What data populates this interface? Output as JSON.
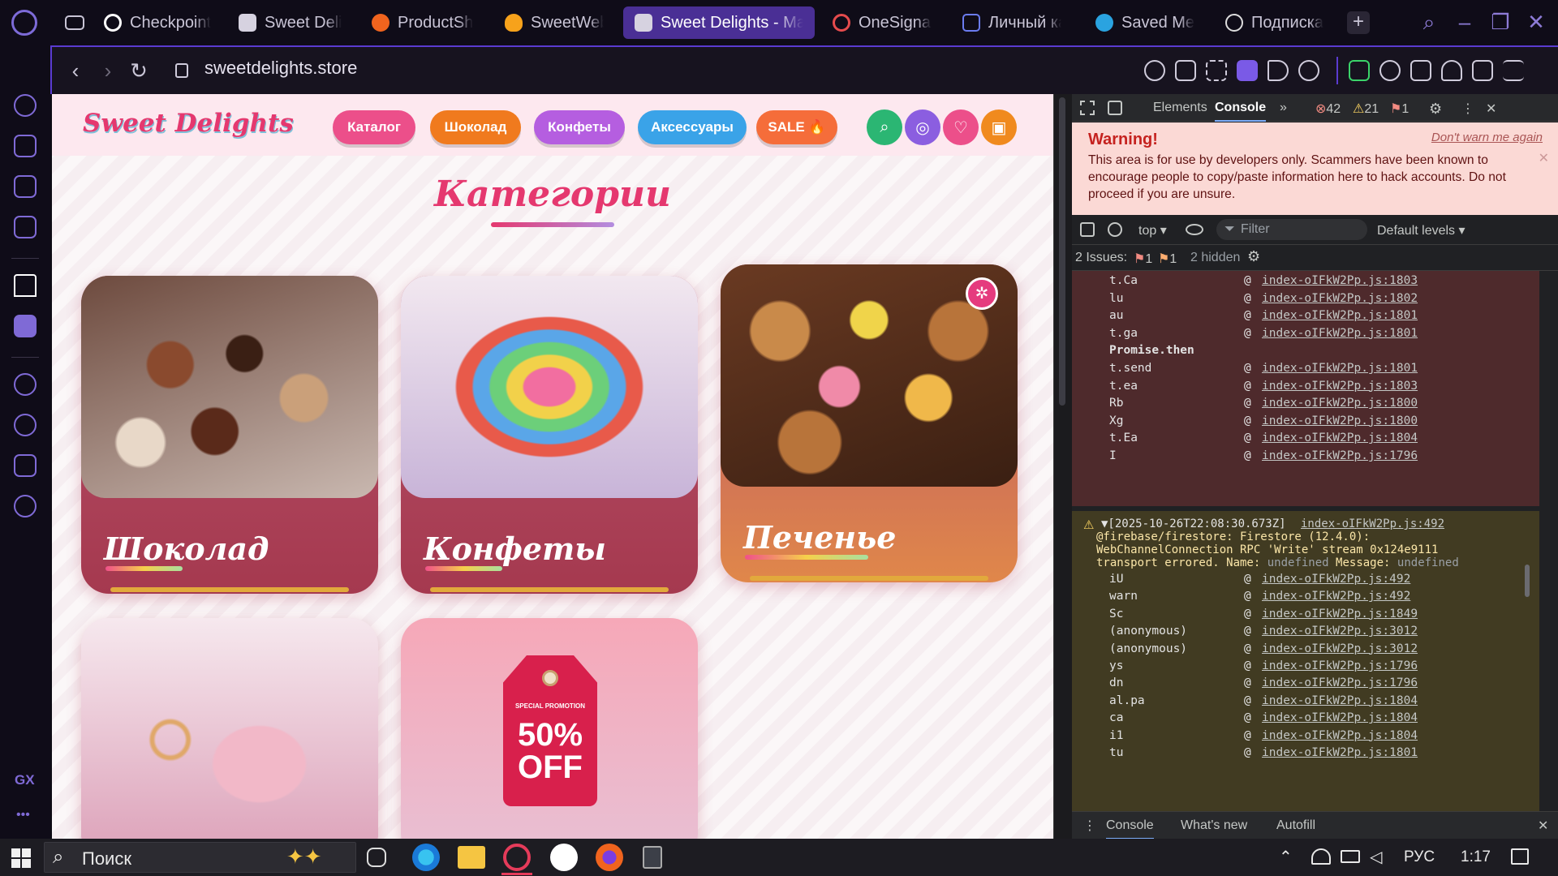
{
  "tabs": [
    {
      "label": "Checkpoint"
    },
    {
      "label": "Sweet Deli"
    },
    {
      "label": "ProductSh"
    },
    {
      "label": "SweetWeb"
    },
    {
      "label": "Sweet Delights - Ma",
      "active": true
    },
    {
      "label": "OneSignal"
    },
    {
      "label": "Личный ка"
    },
    {
      "label": "Saved Mes"
    },
    {
      "label": "Подписка"
    }
  ],
  "address": {
    "url": "sweetdelights.store"
  },
  "sidebar": {
    "bottom_label": "GX",
    "more": "•••"
  },
  "site": {
    "logo": "Sweet Delights",
    "nav": [
      {
        "label": "Каталог",
        "color": "#ec4f8a"
      },
      {
        "label": "Шоколад",
        "color": "#f07a1e"
      },
      {
        "label": "Конфеты",
        "color": "#b55ee0"
      },
      {
        "label": "Аксессуары",
        "color": "#3aa3e8"
      },
      {
        "label": "SALE 🔥",
        "color": "#f56d3a"
      }
    ],
    "section_title": "Категории",
    "categories": [
      {
        "name": "Шоколад"
      },
      {
        "name": "Конфеты"
      },
      {
        "name": "Печенье"
      },
      {
        "name": ""
      },
      {
        "name": ""
      }
    ],
    "promo": {
      "small": "SPECIAL PROMOTION",
      "big1": "50%",
      "big2": "OFF"
    }
  },
  "devtools": {
    "tabs": {
      "elements": "Elements",
      "console": "Console",
      "more": "»"
    },
    "counts": {
      "errors": "42",
      "warnings": "21",
      "info": "1"
    },
    "warning": {
      "title": "Warning!",
      "dont_warn": "Don't warn me again",
      "text": "This area is for use by developers only. Scammers have been known to encourage people to copy/paste information here to hack accounts. Do not proceed if you are unsure."
    },
    "filter": {
      "context": "top ▾",
      "placeholder": "Filter",
      "levels": "Default levels ▾"
    },
    "issues": {
      "label": "2 Issues:",
      "err": "1",
      "warn": "1",
      "hidden": "2 hidden"
    },
    "error_trace": [
      {
        "fn": "t.Ca",
        "link": "index-oIFkW2Pp.js:1803"
      },
      {
        "fn": "lu",
        "link": "index-oIFkW2Pp.js:1802"
      },
      {
        "fn": "au",
        "link": "index-oIFkW2Pp.js:1801"
      },
      {
        "fn": "t.ga",
        "link": "index-oIFkW2Pp.js:1801"
      },
      {
        "fn": "Promise.then",
        "link": ""
      },
      {
        "fn": "t.send",
        "link": "index-oIFkW2Pp.js:1801"
      },
      {
        "fn": "t.ea",
        "link": "index-oIFkW2Pp.js:1803"
      },
      {
        "fn": "Rb",
        "link": "index-oIFkW2Pp.js:1800"
      },
      {
        "fn": "Xg",
        "link": "index-oIFkW2Pp.js:1800"
      },
      {
        "fn": "t.Ea",
        "link": "index-oIFkW2Pp.js:1804"
      },
      {
        "fn": "I",
        "link": "index-oIFkW2Pp.js:1796"
      }
    ],
    "warn_entry": {
      "timestamp": "▼[2025-10-26T22:08:30.673Z]",
      "source": "index-oIFkW2Pp.js:492",
      "line1": "@firebase/firestore: Firestore (12.4.0):",
      "line2": "WebChannelConnection RPC 'Write' stream 0x124e9111",
      "line3a": "transport errored. Name:",
      "undef": "undefined",
      "line3b": "Message:"
    },
    "warn_trace": [
      {
        "fn": "iU",
        "link": "index-oIFkW2Pp.js:492"
      },
      {
        "fn": "warn",
        "link": "index-oIFkW2Pp.js:492"
      },
      {
        "fn": "Sc",
        "link": "index-oIFkW2Pp.js:1849"
      },
      {
        "fn": "(anonymous)",
        "link": "index-oIFkW2Pp.js:3012"
      },
      {
        "fn": "(anonymous)",
        "link": "index-oIFkW2Pp.js:3012"
      },
      {
        "fn": "ys",
        "link": "index-oIFkW2Pp.js:1796"
      },
      {
        "fn": "dn",
        "link": "index-oIFkW2Pp.js:1796"
      },
      {
        "fn": "al.pa",
        "link": "index-oIFkW2Pp.js:1804"
      },
      {
        "fn": "ca",
        "link": "index-oIFkW2Pp.js:1804"
      },
      {
        "fn": "i1",
        "link": "index-oIFkW2Pp.js:1804"
      },
      {
        "fn": "tu",
        "link": "index-oIFkW2Pp.js:1801"
      }
    ],
    "drawer": {
      "console": "Console",
      "whatsnew": "What's new",
      "autofill": "Autofill"
    }
  },
  "taskbar": {
    "search": "Поиск",
    "lang": "РУС",
    "time": "1:17"
  }
}
